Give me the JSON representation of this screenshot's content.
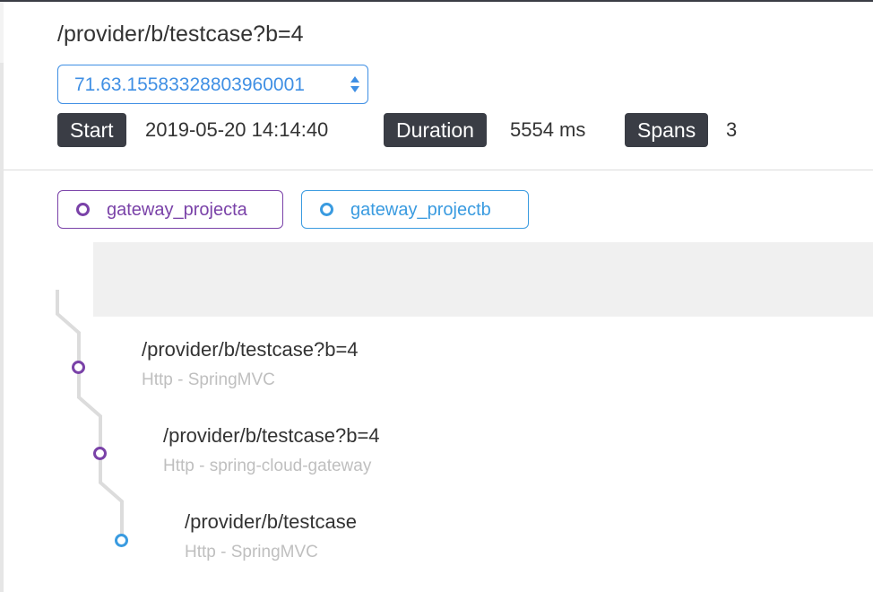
{
  "trace": {
    "title": "/provider/b/testcase?b=4",
    "selected_trace_id": "71.63.15583328803960001",
    "start_label": "Start",
    "start_value": "2019-05-20 14:14:40",
    "duration_label": "Duration",
    "duration_value": "5554 ms",
    "spans_label": "Spans",
    "spans_value": "3"
  },
  "legend": {
    "items": [
      {
        "label": "gateway_projecta",
        "color": "#7a42a8"
      },
      {
        "label": "gateway_projectb",
        "color": "#3a9be0"
      }
    ]
  },
  "spans": [
    {
      "endpoint": "/provider/b/testcase?b=4",
      "layer": "Http - SpringMVC",
      "service_color": "#7a42a8"
    },
    {
      "endpoint": "/provider/b/testcase?b=4",
      "layer": "Http - spring-cloud-gateway",
      "service_color": "#7a42a8"
    },
    {
      "endpoint": "/provider/b/testcase",
      "layer": "Http - SpringMVC",
      "service_color": "#3a9be0"
    }
  ],
  "colors": {
    "accent": "#3f8fe4",
    "badge_bg": "#3a3d45",
    "service_a": "#7a42a8",
    "service_b": "#3a9be0"
  },
  "icons": {
    "select_arrows": "sort-arrows-icon",
    "legend_dot": "circle-outline-icon"
  }
}
